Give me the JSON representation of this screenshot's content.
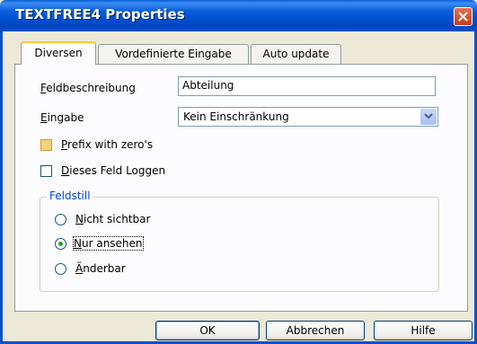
{
  "window": {
    "title": "TEXTFREE4 Properties"
  },
  "tabs": [
    {
      "label": "Diversen",
      "active": true
    },
    {
      "label": "Vordefinierte Eingabe",
      "active": false
    },
    {
      "label": "Auto update",
      "active": false
    }
  ],
  "form": {
    "feldbeschreibung": {
      "label_key": "F",
      "label_rest": "eldbeschreibung",
      "value": "Abteilung"
    },
    "eingabe": {
      "label_key": "E",
      "label_rest": "ingabe",
      "value": "Kein Einschränkung"
    },
    "prefix": {
      "label_key": "P",
      "label_rest": "refix with zero's",
      "checked": false
    },
    "loggen": {
      "label_key": "D",
      "label_rest": "ieses Feld Loggen",
      "checked": false
    }
  },
  "feldstill": {
    "title": "Feldstill",
    "options": [
      {
        "key": "N",
        "rest": "icht sichtbar",
        "selected": false
      },
      {
        "key": "N",
        "rest": "ur ansehen",
        "selected": true
      },
      {
        "key": "Ä",
        "rest": "nderbar",
        "selected": false
      }
    ]
  },
  "buttons": {
    "ok": "OK",
    "cancel": "Abbrechen",
    "help": "Hilfe"
  },
  "colors": {
    "titlebar": "#0A5FD9",
    "dialog_bg": "#ECE9D8",
    "group_title": "#0046D5",
    "radio_dot": "#21A121"
  }
}
